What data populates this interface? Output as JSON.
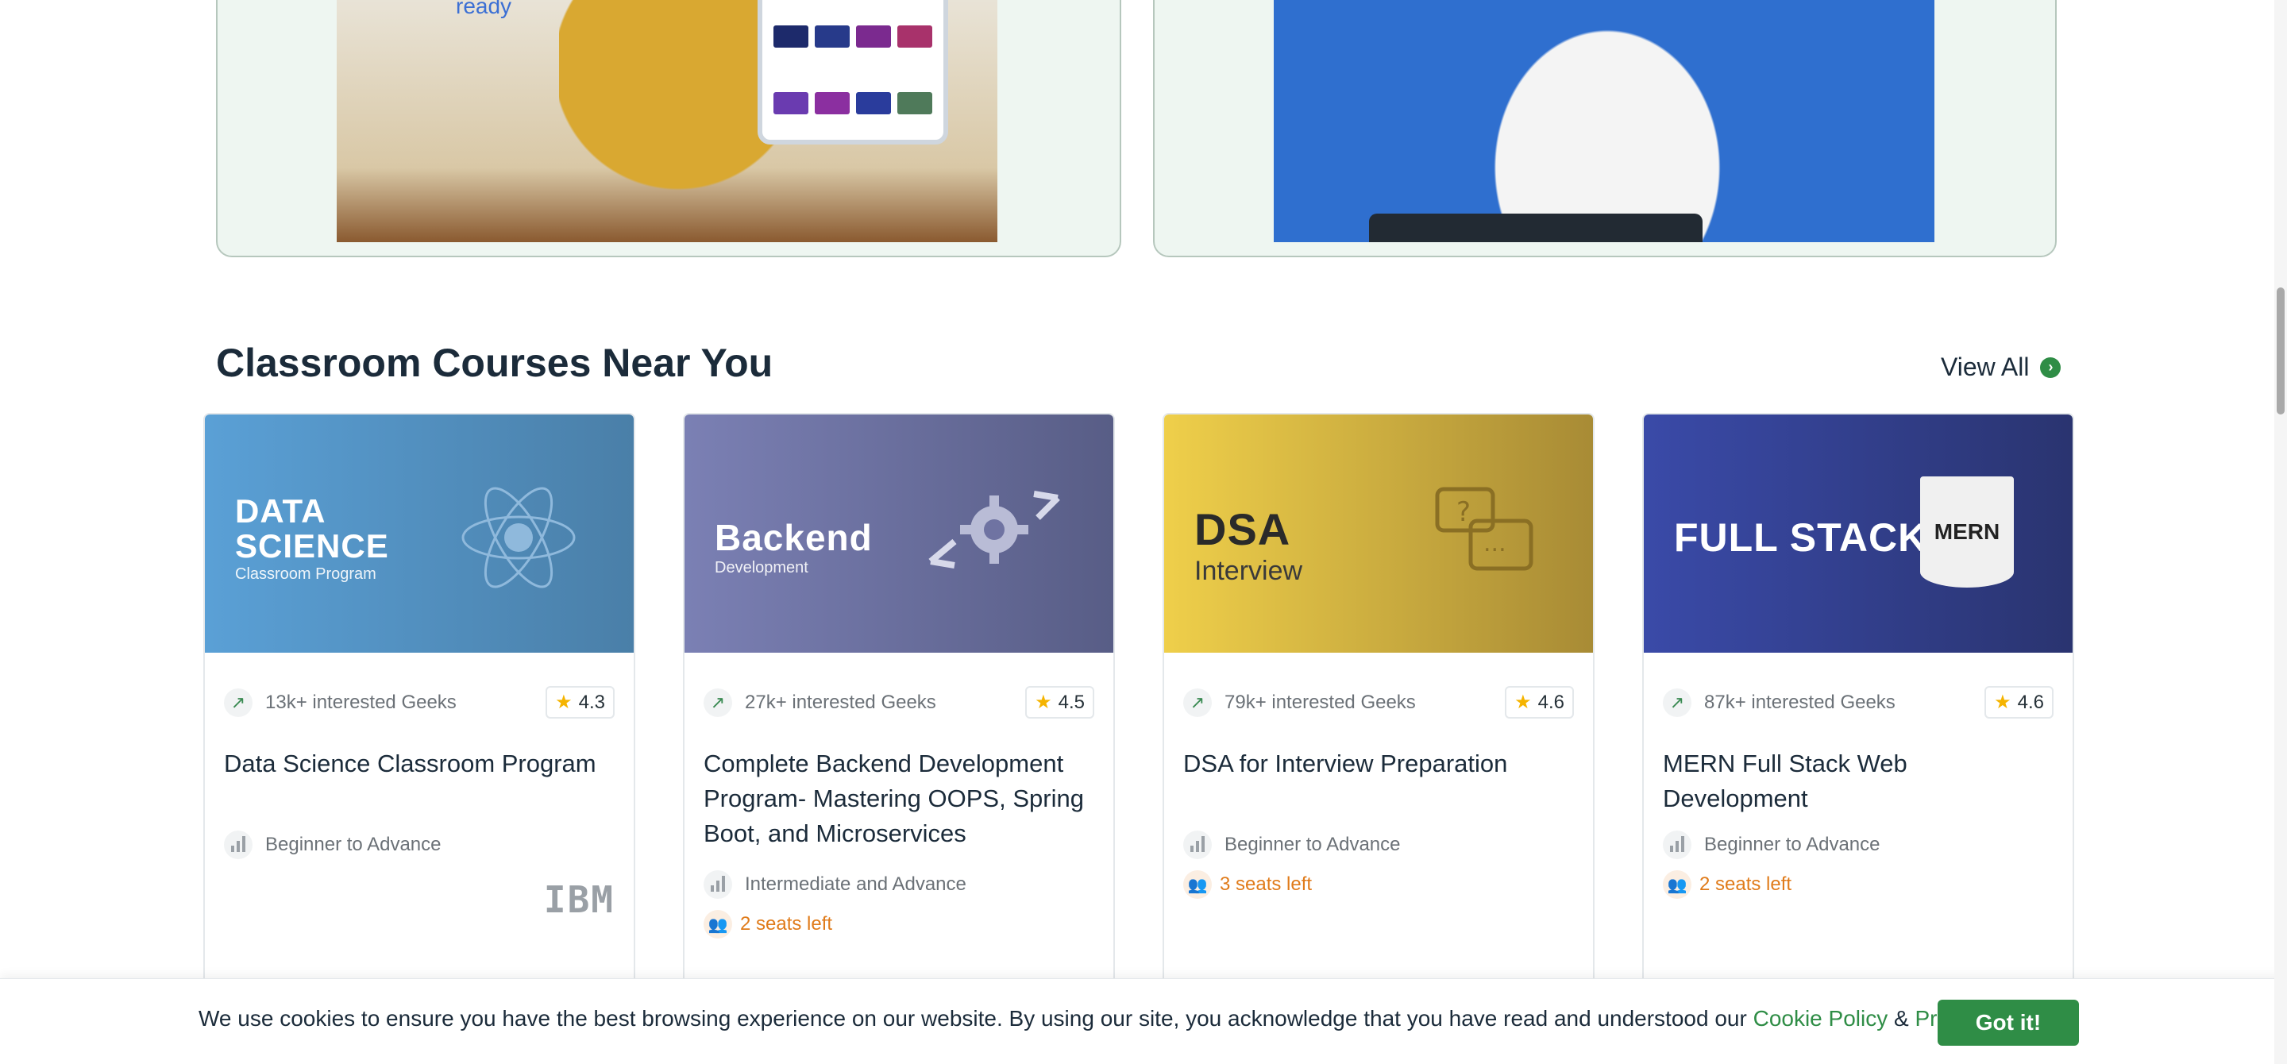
{
  "video_cards": {
    "left": {
      "overlay_text": "ready"
    },
    "right": {}
  },
  "section": {
    "title": "Classroom Courses Near You",
    "view_all": "View All"
  },
  "courses": [
    {
      "banner_title_1": "DATA",
      "banner_title_2": "SCIENCE",
      "banner_subtitle": "Classroom Program",
      "interested": "13k+ interested Geeks",
      "rating": "4.3",
      "title": "Data Science Classroom Program",
      "level": "Beginner to Advance",
      "partner_logo": "IBM"
    },
    {
      "banner_title_1": "Backend",
      "banner_subtitle": "Development",
      "interested": "27k+ interested Geeks",
      "rating": "4.5",
      "title": "Complete Backend Development Program- Mastering OOPS, Spring Boot, and Microservices",
      "level": "Intermediate and Advance",
      "seats": "2 seats left"
    },
    {
      "banner_title_1": "DSA",
      "banner_subtitle": "Interview",
      "interested": "79k+ interested Geeks",
      "rating": "4.6",
      "title": "DSA for Interview Preparation",
      "level": "Beginner to Advance",
      "seats": "3 seats left"
    },
    {
      "banner_title_1": "FULL STACK",
      "banner_badge": "MERN",
      "interested": "87k+ interested Geeks",
      "rating": "4.6",
      "title": "MERN Full Stack Web Development",
      "level": "Beginner to Advance",
      "seats": "2 seats left"
    }
  ],
  "cookie": {
    "text": "We use cookies to ensure you have the best browsing experience on our website. By using our site, you acknowledge that you have read and understood our",
    "cookie_policy": "Cookie Policy",
    "amp": "&",
    "privacy_policy": "Privacy Policy",
    "button": "Got it!"
  },
  "colors": {
    "accent_green": "#2f8d46",
    "seats_orange": "#e07b1a"
  }
}
